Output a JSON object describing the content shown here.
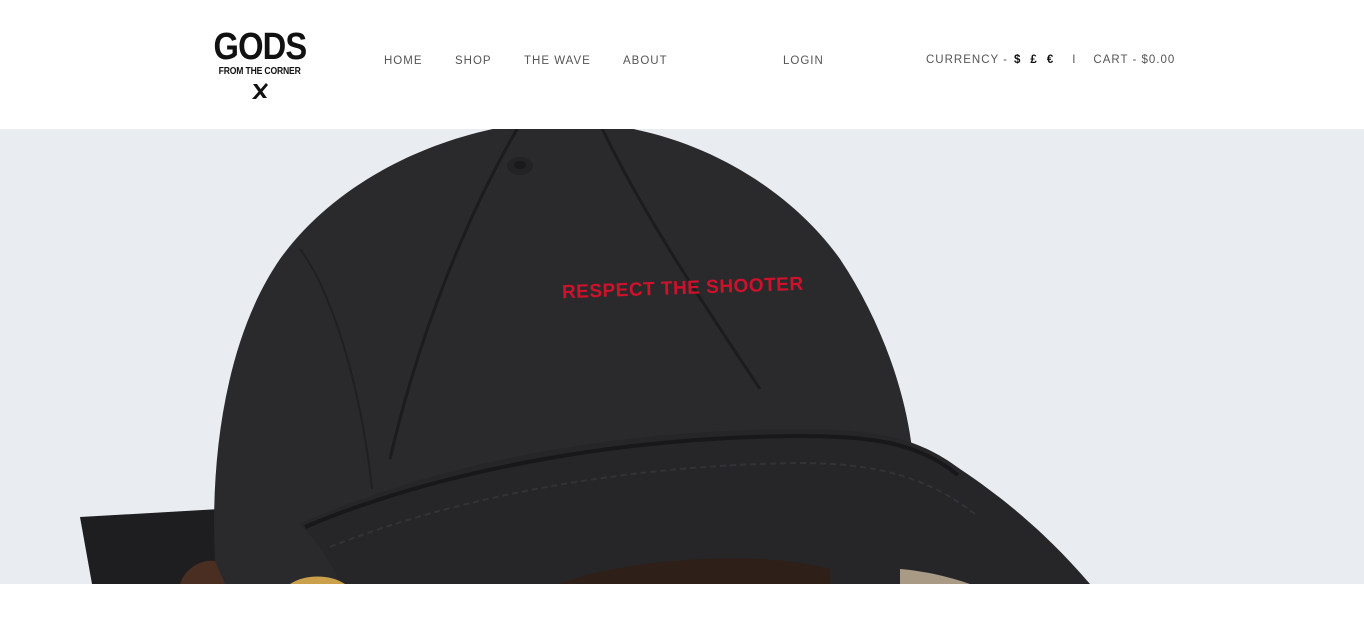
{
  "logo": {
    "title": "GODS",
    "subtitle": "FROM THE CORNER"
  },
  "nav": {
    "items": [
      {
        "label": "HOME"
      },
      {
        "label": "SHOP"
      },
      {
        "label": "THE WAVE"
      },
      {
        "label": "ABOUT"
      }
    ],
    "login": "LOGIN"
  },
  "utility": {
    "currency_label": "CURRENCY -",
    "currencies": [
      "$",
      "£",
      "€"
    ],
    "separator": "I",
    "cart": "CART - $0.00"
  },
  "hero": {
    "embroidery_text": "RESPECT THE SHOOTER",
    "colors": {
      "background": "#e9edf1",
      "cap": "#2a2a2d",
      "embroidery": "#d0112b"
    }
  }
}
